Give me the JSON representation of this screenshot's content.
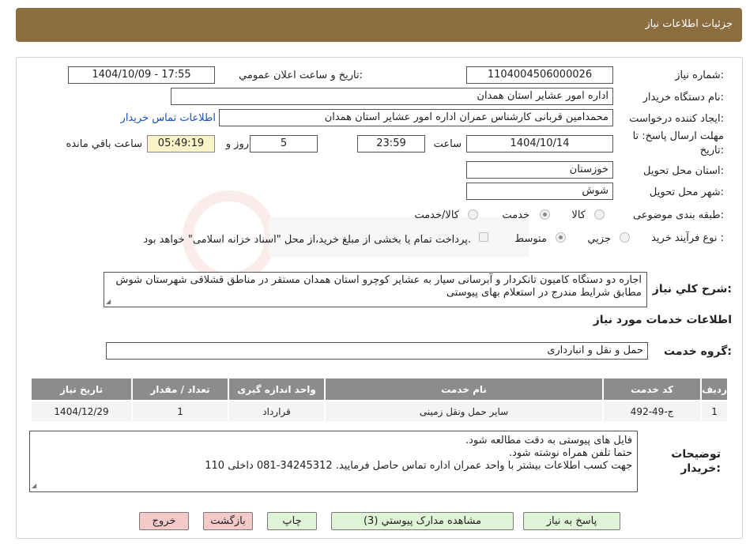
{
  "header": {
    "title": "جزئیات اطلاعات نیاز"
  },
  "form": {
    "need_number_label": "شماره نیاز:",
    "need_number": "1104004506000026",
    "announce_label": "تاریخ و ساعت اعلان عمومي:",
    "announce_value": "1404/10/09 - 17:55",
    "buyer_org_label": "نام دستگاه خریدار:",
    "buyer_org": "اداره امور عشایر استان همدان",
    "requester_label": "ایجاد کننده درخواست:",
    "requester": "محمدامین قربانی کارشناس عمران اداره امور عشایر استان همدان",
    "contact_link": "اطلاعات تماس خریدار",
    "deadline_label_1": "مهلت ارسال پاسخ: تا",
    "deadline_label_2": "تاریخ:",
    "deadline_date": "1404/10/14",
    "time_label": "ساعت",
    "deadline_time": "23:59",
    "days_value": "5",
    "days_label": "روز و",
    "remaining_time": "05:49:19",
    "remaining_label": "ساعت باقي مانده",
    "province_label": "استان محل تحویل:",
    "province": "خوزستان",
    "city_label": "شهر محل تحویل:",
    "city": "شوش",
    "category_label": "طبقه بندی موضوعی:",
    "category_options": [
      "کالا",
      "خدمت",
      "کالا/خدمت"
    ],
    "category_selected": "خدمت",
    "process_label": "نوع فرآیند خرید :",
    "process_options": [
      "جزيي",
      "متوسط"
    ],
    "process_selected": "متوسط",
    "payment_note": "پرداخت تمام یا بخشی از مبلغ خرید،از محل \"اسناد خزانه اسلامی\" خواهد بود."
  },
  "description": {
    "label": "شرح كلي نياز:",
    "text": "اجاره دو دستگاه کامیون تانکردار و آبرسانی سیار به عشایر کوچرو استان همدان مستقر در مناطق قشلاقی شهرستان شوش مطابق شرایط مندرج در استعلام بهای پیوستی"
  },
  "services": {
    "section_title": "اطلاعات خدمات مورد نیاز",
    "group_label": "گروه خدمت:",
    "group_value": "حمل و نقل و انبارداری",
    "columns": [
      "رديف",
      "کد خدمت",
      "نام خدمت",
      "واحد اندازه گيری",
      "تعداد / مقدار",
      "تاريخ نياز"
    ],
    "rows": [
      [
        "1",
        "ج-49-492",
        "سایر حمل ونقل زمینی",
        "قرارداد",
        "1",
        "1404/12/29"
      ]
    ]
  },
  "buyer_notes": {
    "label_1": "توضیحات",
    "label_2": "خریدار:",
    "lines": [
      "فایل های پیوستی به دقت مطالعه شود.",
      "حتما تلفن همراه نوشته شود.",
      "جهت کسب اطلاعات بیشتر با واحد عمران اداره تماس حاصل فرمایید. 34245312-081  داخلی 110"
    ]
  },
  "buttons": {
    "reply": "پاسخ به نیاز",
    "attachments": "مشاهده مدارک پیوستي (3)",
    "print": "چاپ",
    "back": "بازگشت",
    "exit": "خروج"
  },
  "colors": {
    "header": "#8b6d3f",
    "button_green": "#dff3d6",
    "button_red": "#f6c9c9",
    "table_header": "#8c8c8c"
  }
}
